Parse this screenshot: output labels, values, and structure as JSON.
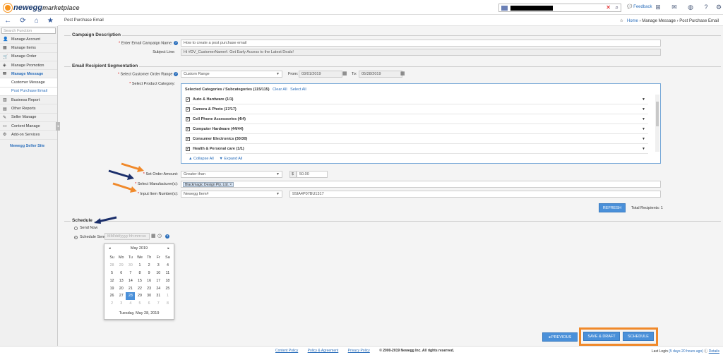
{
  "app": {
    "brand": "newegg",
    "brand_sub": "marketplace",
    "feedback": "Feedback",
    "icons": [
      "sitemap-icon",
      "mail-icon",
      "globe-icon",
      "help-icon",
      "gear-icon"
    ]
  },
  "header": {
    "page_title": "Post Purchase Email",
    "breadcrumb": {
      "home": "Home",
      "mid": "Manage Message",
      "current": "Post Purchase Email"
    }
  },
  "sidebar": {
    "search_placeholder": "Search Function",
    "items": [
      {
        "label": "Manage Account",
        "icon": "user-icon"
      },
      {
        "label": "Manage Items",
        "icon": "box-icon"
      },
      {
        "label": "Manage Order",
        "icon": "cart-icon"
      },
      {
        "label": "Manage Promotion",
        "icon": "tag-icon"
      },
      {
        "label": "Manage Message",
        "icon": "envelope-icon",
        "active": true
      },
      {
        "label": "Customer Message",
        "sub": true
      },
      {
        "label": "Post Purchase Email",
        "sub": true,
        "selected": true
      },
      {
        "label": "Business Report",
        "icon": "chart-icon"
      },
      {
        "label": "Other Reports",
        "icon": "report-icon"
      },
      {
        "label": "Seller Manage",
        "icon": "seller-icon"
      },
      {
        "label": "Content Manage",
        "icon": "folder-icon"
      },
      {
        "label": "Add-on Services",
        "icon": "gears-icon"
      }
    ],
    "seller_site": "Newegg Seller Site"
  },
  "campaign": {
    "legend": "Campaign Description",
    "name_label": "Enter Email Campaign Name:",
    "name_value": "How to create a post purchase email",
    "subject_label": "Subject Line:",
    "subject_value": "Hi #DV_CustomerName#. Get Early Access to the Latest Deals!"
  },
  "segmentation": {
    "legend": "Email Recipient Segmentation",
    "range_label": "Select Customer Order Range",
    "range_value": "Custom Range",
    "from_label": "From:",
    "from_value": "03/01/2019",
    "to_label": "To:",
    "to_value": "05/28/2019",
    "category_label": "Select Product Category:",
    "category_header": "Selected Categories / Subcategories (115/115)",
    "clear_all": "Clear All",
    "select_all": "Select All",
    "categories": [
      "Auto & Hardware (1/1)",
      "Camera & Photo (17/17)",
      "Cell Phone Accessories (4/4)",
      "Computer Hardware (44/44)",
      "Consumer Electronics (30/30)",
      "Health & Personal care (1/1)"
    ],
    "collapse_all": "Collapse All",
    "expand_all": "Expand All",
    "amount_label": "Set Order Amount:",
    "amount_op": "Greater than",
    "amount_currency": "$",
    "amount_value": "50.00",
    "mfg_label": "Select Manufacturer(s):",
    "mfg_tag": "Blackmagic Design Pty. Ltd.",
    "item_label": "Input Item Number(s):",
    "item_type": "Newegg Item#",
    "item_value": "9SIA4P07BU1317",
    "refresh": "REFRESH",
    "total_recipients": "Total Recipients: 1"
  },
  "schedule": {
    "legend": "Schedule",
    "send_now": "Send Now",
    "schedule_send": "Schedule Send",
    "datetime_placeholder": "MM/dd/yyyy hh:mm:ss"
  },
  "calendar": {
    "month": "May 2019",
    "days": [
      "Su",
      "Mo",
      "Tu",
      "We",
      "Th",
      "Fr",
      "Sa"
    ],
    "weeks": [
      [
        "28",
        "29",
        "30",
        "1",
        "2",
        "3",
        "4"
      ],
      [
        "5",
        "6",
        "7",
        "8",
        "9",
        "10",
        "11"
      ],
      [
        "12",
        "13",
        "14",
        "15",
        "16",
        "17",
        "18"
      ],
      [
        "19",
        "20",
        "21",
        "22",
        "23",
        "24",
        "25"
      ],
      [
        "26",
        "27",
        "28",
        "29",
        "30",
        "31",
        "1"
      ],
      [
        "2",
        "3",
        "4",
        "5",
        "6",
        "7",
        "8"
      ]
    ],
    "today_text": "Tuesday, May 28, 2019"
  },
  "actions": {
    "previous": "PREVIOUS",
    "save_draft": "SAVE & DRAFT",
    "schedule": "SCHEDULE"
  },
  "footer": {
    "links": [
      "Content Policy",
      "Policy & Agreement",
      "Privacy Policy"
    ],
    "copyright": "© 2000-2019 Newegg Inc. All rights reserved.",
    "last_login": "Last Login",
    "login_ago": "(5 days 20 hours ago)",
    "details": "Details"
  },
  "colors": {
    "accent": "#2a6ebb",
    "highlight": "#f0892a",
    "arrow_orange": "#f0892a",
    "arrow_navy": "#1b2f6b"
  }
}
